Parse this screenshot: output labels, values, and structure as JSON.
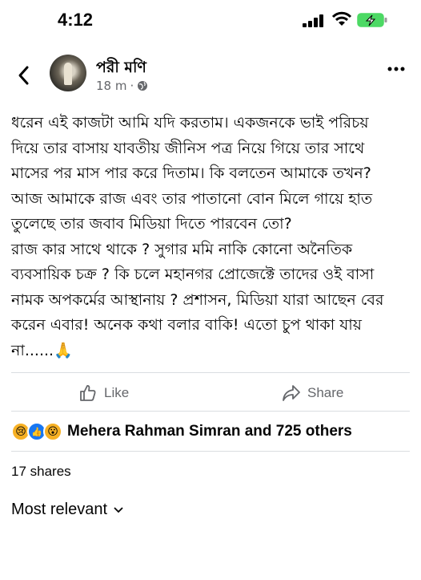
{
  "status_bar": {
    "time": "4:12"
  },
  "post": {
    "author": "পরী মণি",
    "timestamp": "18 m",
    "separator": "·",
    "body_lines": [
      "ধরেন এই কাজটা আমি যদি করতাম। একজনকে ভাই পরিচয়",
      "দিয়ে তার বাসায় যাবতীয় জীনিস পত্র নিয়ে গিয়ে তার সাথে",
      "মাসের পর মাস পার করে দিতাম। কি বলতেন আমাকে তখন?",
      "আজ আমাকে রাজ এবং তার পাতানো বোন মিলে গায়ে হাত",
      "তুলেছে তার জবাব মিডিয়া দিতে পারবেন তো?",
      "রাজ কার সাথে থাকে ? সুগার মমি নাকি কোনো অনৈতিক",
      "ব্যবসায়িক চক্র ? কি চলে মহানগর প্রোজেক্টে তাদের ওই বাসা",
      "নামক অপকর্মের আস্থানায় ? প্রশাসন, মিডিয়া যারা আছেন বের",
      "করেন এবার! অনেক কথা বলার বাকি! এতো চুপ থাকা যায়",
      "না......🙏"
    ]
  },
  "actions": {
    "like_label": "Like",
    "share_label": "Share"
  },
  "reactions": {
    "icons": [
      "sad-reaction",
      "like-reaction",
      "wow-reaction"
    ],
    "summary": "Mehera Rahman Simran and 725 others"
  },
  "shares_text": "17 shares",
  "sort_label": "Most relevant",
  "colors": {
    "accent": "#1877f2",
    "muted": "#65676b",
    "divider": "#dadde1"
  }
}
